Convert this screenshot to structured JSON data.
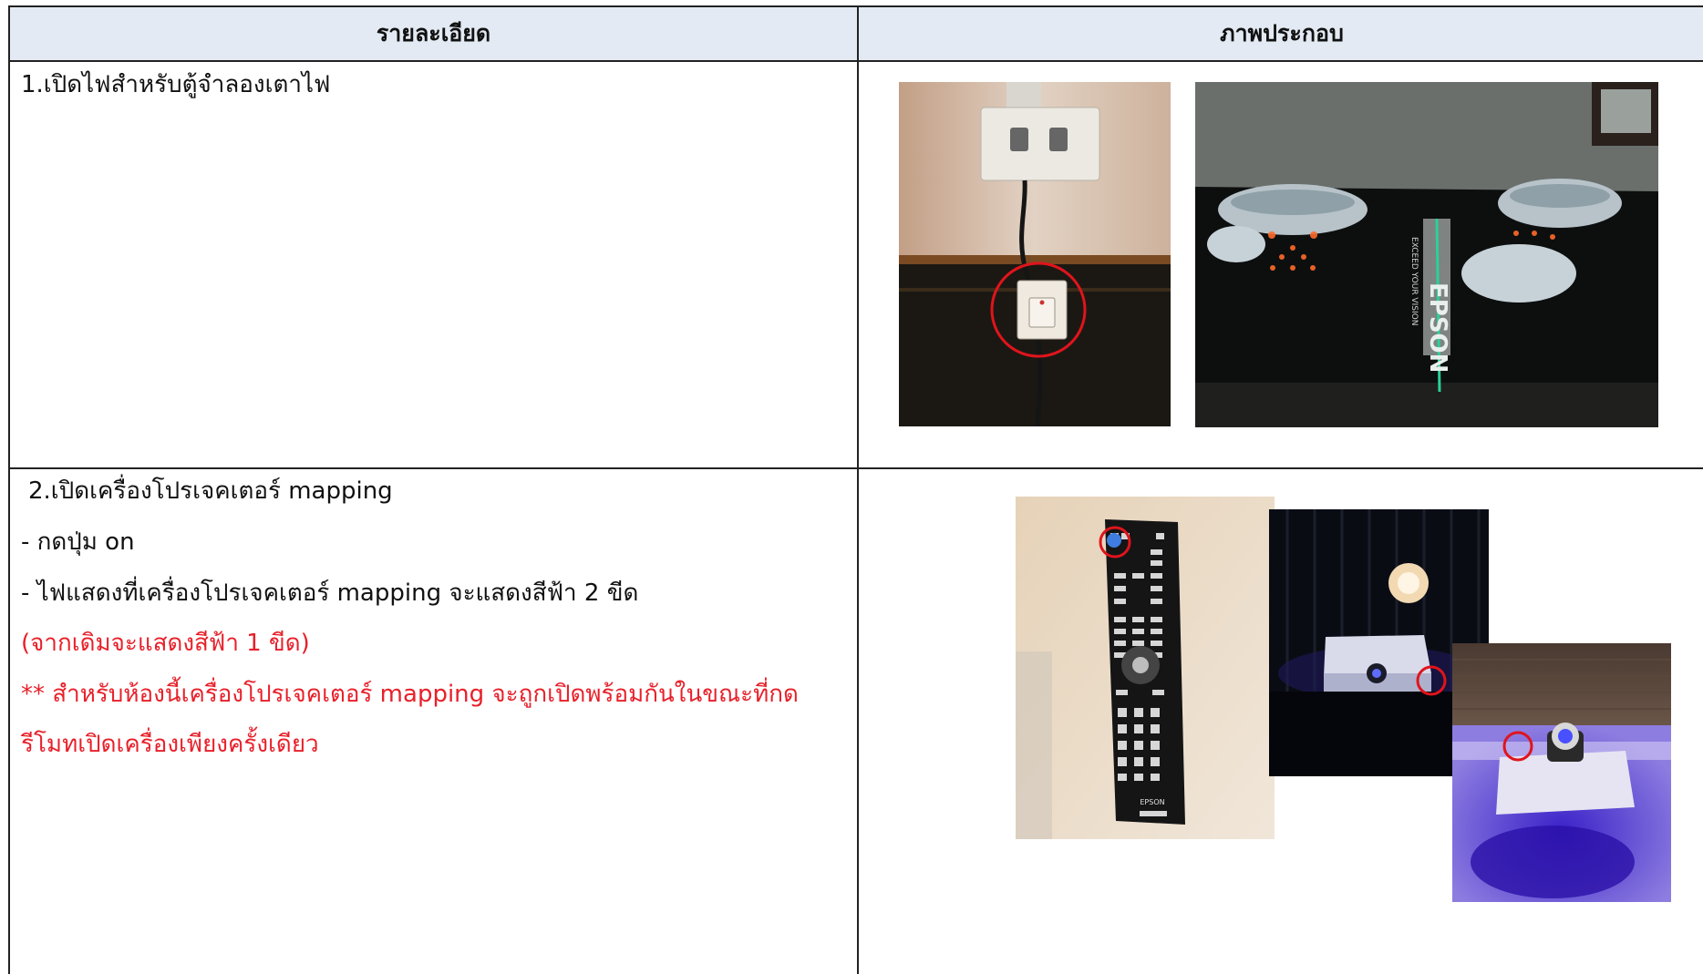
{
  "table": {
    "headers": {
      "details": "รายละเอียด",
      "illustration": "ภาพประกอบ"
    },
    "rows": [
      {
        "step": "1.เปิดไฟสำหรับตู้จำลองเตาไฟ",
        "lines": []
      },
      {
        "step": "2.เปิดเครื่องโปรเจคเตอร์ mapping",
        "lines": [
          "- กดปุ่ม on",
          "- ไฟแสดงที่เครื่องโปรเจคเตอร์ mapping จะแสดงสีฟ้า 2 ขีด"
        ],
        "red_lines": [
          "(จากเดิมจะแสดงสีฟ้า 1 ขีด)",
          "** สำหรับห้องนี้เครื่องโปรเจคเตอร์ mapping จะถูกเปิดพร้อมกันในขณะที่กด",
          "รีโมทเปิดเครื่องเพียงครั้งเดียว"
        ]
      }
    ]
  },
  "photo_text": {
    "brand": "EPSON",
    "slogan": "EXCEED YOUR VISION"
  },
  "colors": {
    "header_bg": "#e3eaf3",
    "note_red": "#e8202a",
    "highlight_circle": "#e0141c"
  }
}
